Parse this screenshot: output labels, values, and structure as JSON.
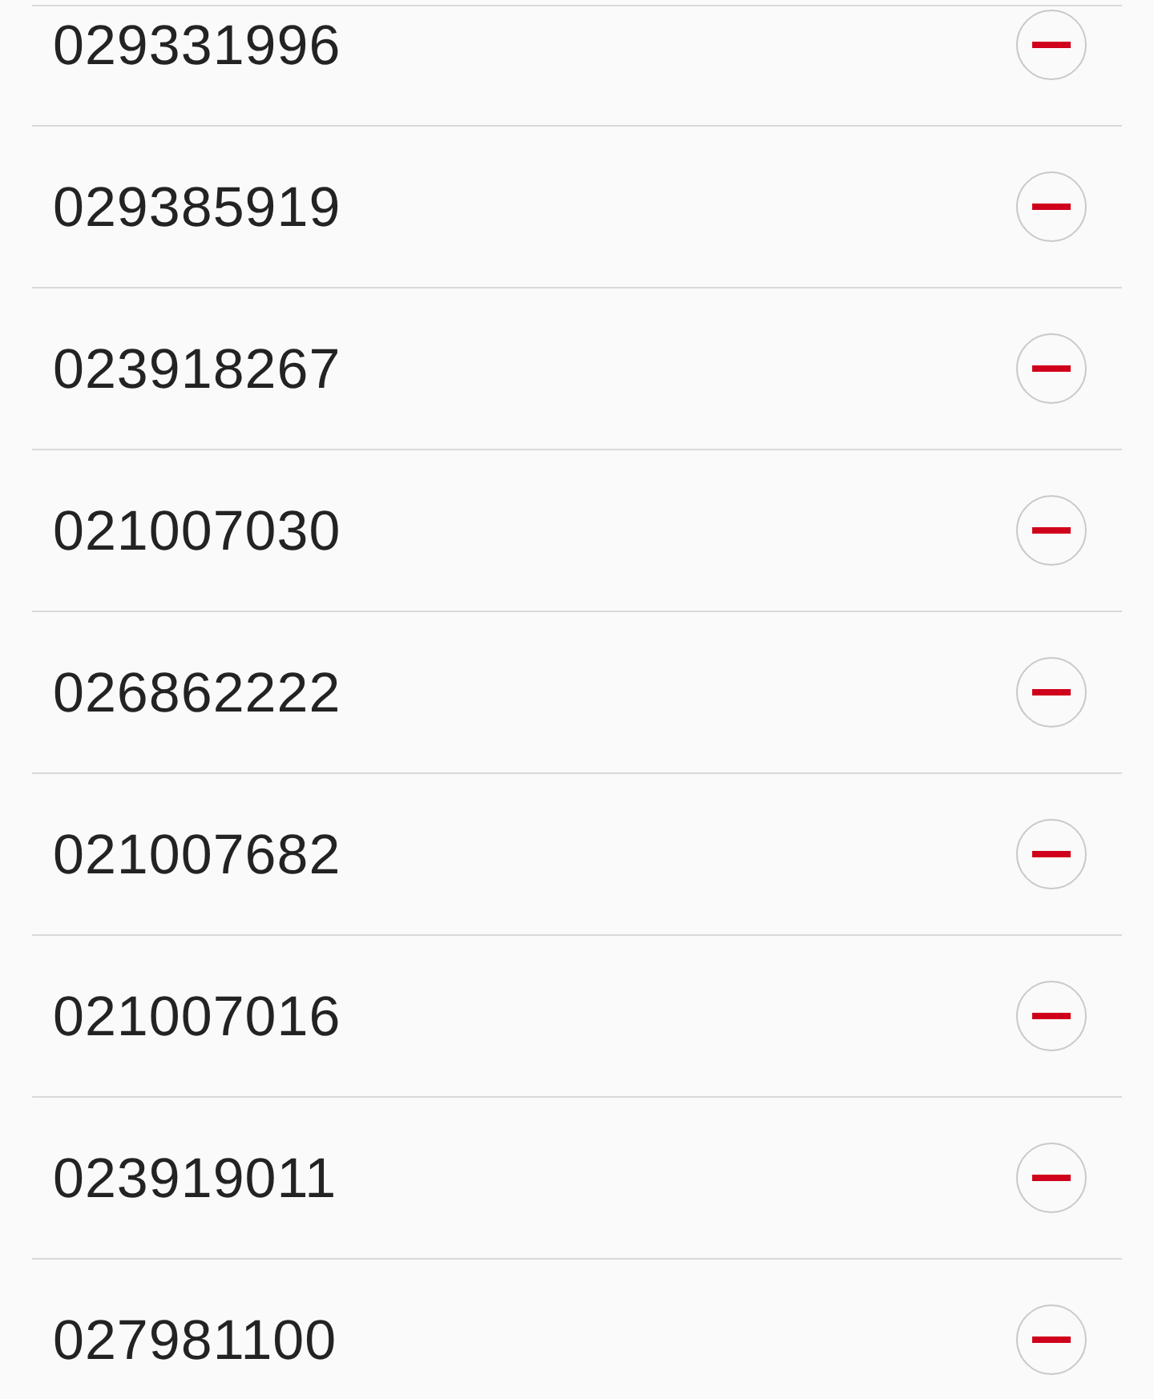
{
  "rows": [
    {
      "number": "029331996"
    },
    {
      "number": "029385919"
    },
    {
      "number": "023918267"
    },
    {
      "number": "021007030"
    },
    {
      "number": "026862222"
    },
    {
      "number": "021007682"
    },
    {
      "number": "021007016"
    },
    {
      "number": "023919011"
    },
    {
      "number": "027981100"
    }
  ]
}
